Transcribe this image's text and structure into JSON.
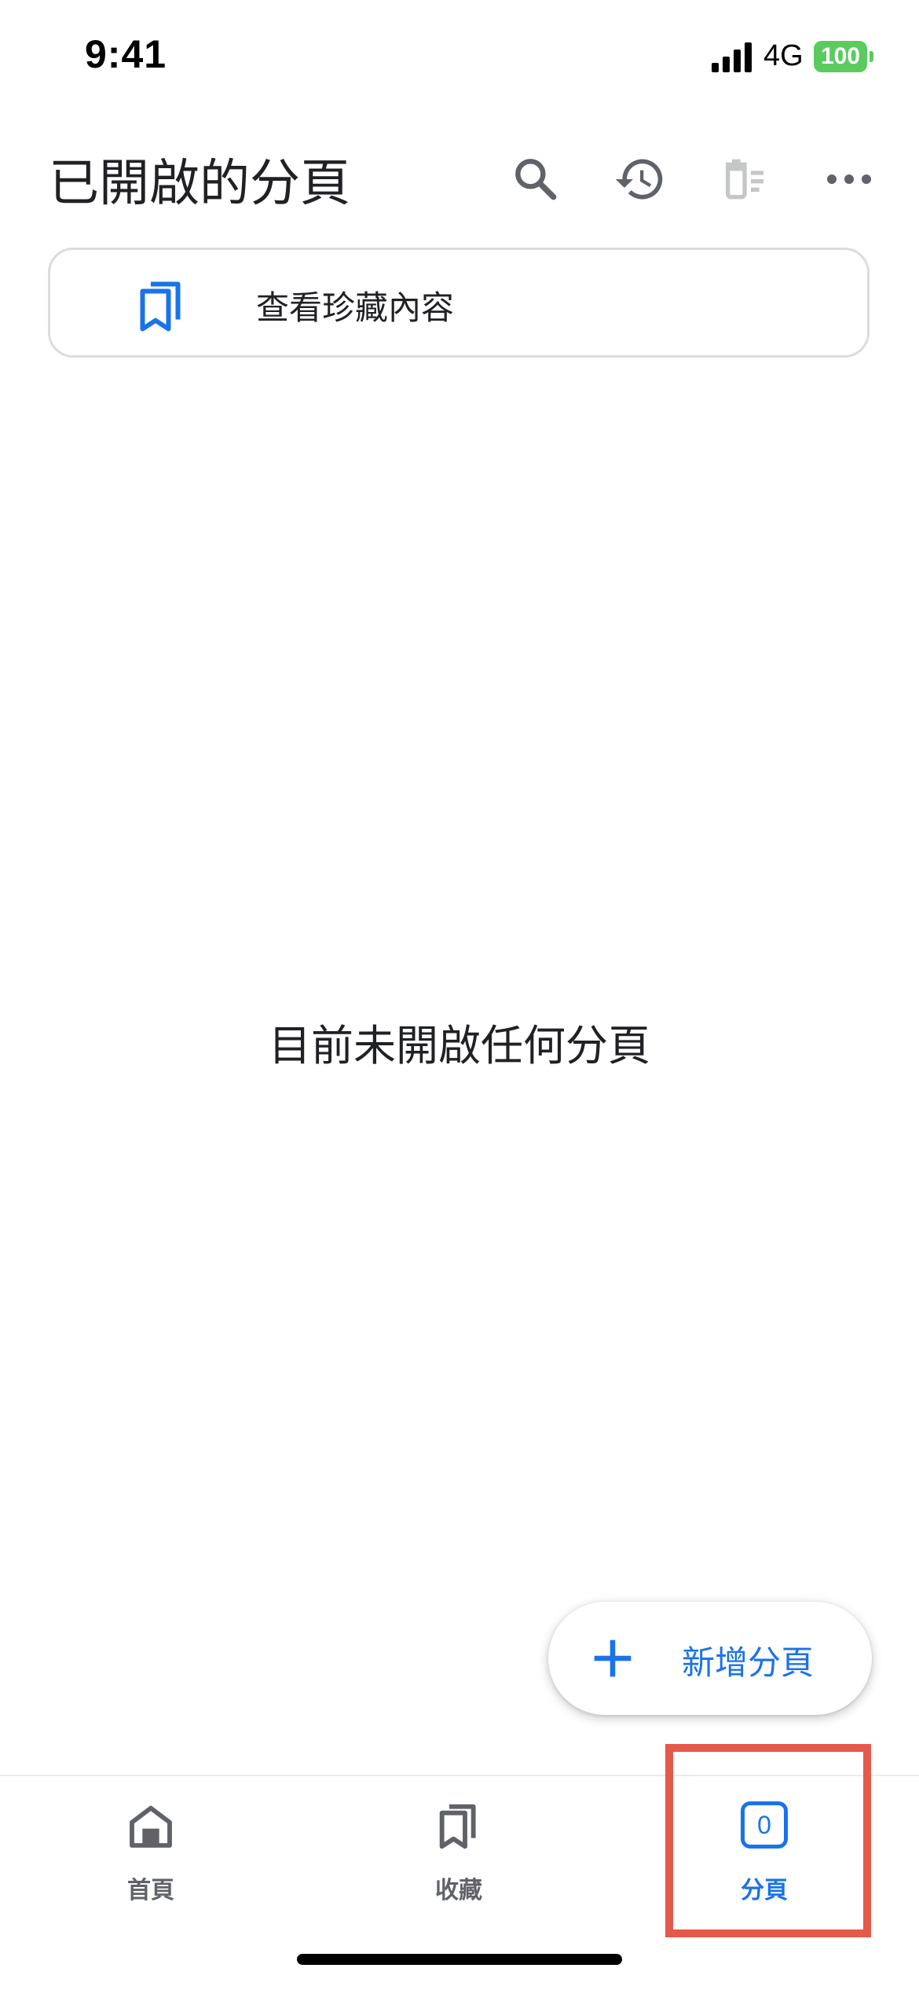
{
  "status_bar": {
    "time": "9:41",
    "network": "4G",
    "battery": "100",
    "signal_icon": "cellular-signal-icon"
  },
  "header": {
    "title": "已開啟的分頁",
    "icons": [
      "search-icon",
      "history-icon",
      "delete-icon",
      "more-icon"
    ]
  },
  "bookmarks_card": {
    "label": "查看珍藏內容",
    "icon": "bookmarks-icon"
  },
  "empty_state": {
    "message": "目前未開啟任何分頁"
  },
  "fab": {
    "label": "新增分頁",
    "icon": "plus-icon"
  },
  "bottom_nav": {
    "items": [
      {
        "label": "首頁",
        "icon": "home-icon",
        "active": false
      },
      {
        "label": "收藏",
        "icon": "bookmarks-icon",
        "active": false
      },
      {
        "label": "分頁",
        "icon": "tab-count-icon",
        "active": true
      }
    ],
    "tab_count": "0"
  },
  "colors": {
    "accent": "#1a73e8",
    "text": "#202124",
    "icon_gray": "#5f6368",
    "highlight": "#e5594b",
    "battery": "#5ccb5f"
  }
}
